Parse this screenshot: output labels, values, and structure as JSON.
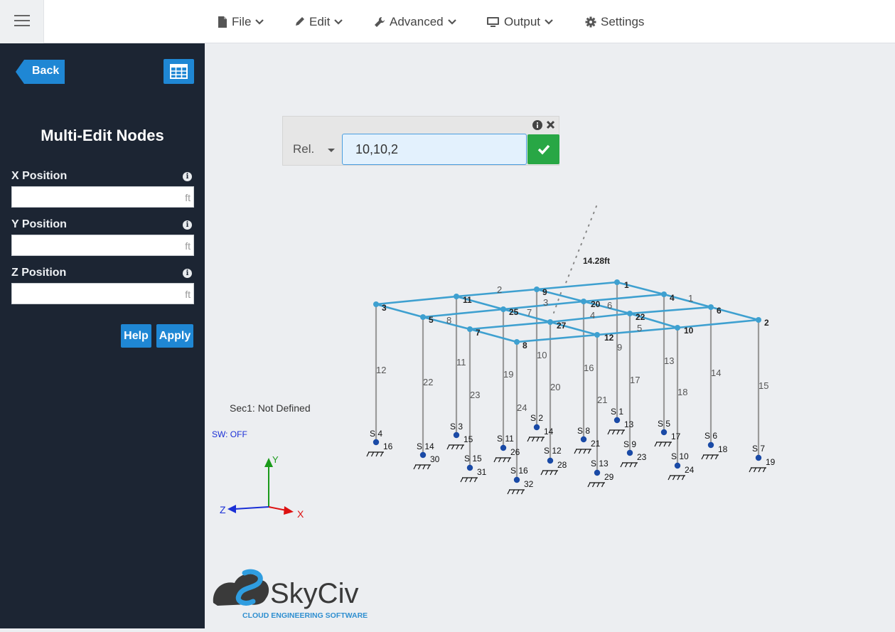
{
  "menu": {
    "file": "File",
    "edit": "Edit",
    "advanced": "Advanced",
    "output": "Output",
    "settings": "Settings"
  },
  "sidebar": {
    "back_label": "Back",
    "title": "Multi-Edit Nodes",
    "fields": [
      {
        "label": "X Position",
        "value": "",
        "unit": "ft"
      },
      {
        "label": "Y Position",
        "value": "",
        "unit": "ft"
      },
      {
        "label": "Z Position",
        "value": "",
        "unit": "ft"
      }
    ],
    "help_label": "Help",
    "apply_label": "Apply"
  },
  "command": {
    "mode": "Rel.",
    "value": "10,10,2"
  },
  "viewport": {
    "section_info": "Sec1: Not Defined",
    "sw_status": "SW: OFF",
    "dimension_label": "14.28ft",
    "axes": {
      "x": "X",
      "y": "Y",
      "z": "Z"
    },
    "nodes": [
      "1",
      "2",
      "3",
      "4",
      "5",
      "6",
      "7",
      "8",
      "9",
      "10",
      "11",
      "12",
      "13",
      "14",
      "15",
      "16",
      "17",
      "18",
      "19",
      "20",
      "21",
      "22",
      "23",
      "24",
      "25",
      "26",
      "27",
      "28",
      "29",
      "30",
      "31",
      "32"
    ],
    "supports": [
      "S 1",
      "S 2",
      "S 3",
      "S 4",
      "S 5",
      "S 6",
      "S 7",
      "S 8",
      "S 9",
      "S 10",
      "S 11",
      "S 12",
      "S 13",
      "S 14",
      "S 15",
      "S 16"
    ]
  },
  "logo": {
    "name": "SkyCiv",
    "tagline": "CLOUD ENGINEERING SOFTWARE"
  },
  "colors": {
    "sidebar_bg": "#1c2533",
    "accent_blue": "#1f87d4",
    "member_blue": "#3ea0d0",
    "column_gray": "#9a9a9a",
    "confirm_green": "#28a745",
    "node_blue": "#1a4aa6"
  }
}
